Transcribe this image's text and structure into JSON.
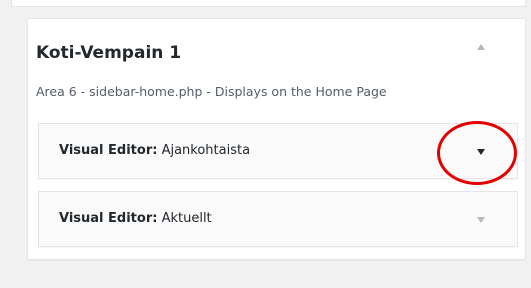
{
  "sidebar": {
    "title": "Koti-Vempain 1",
    "description": "Area 6 - sidebar-home.php - Displays on the Home Page",
    "widgets": [
      {
        "type_label": "Visual Editor:",
        "name": " Ajankohtaista",
        "arrow_color": "#23282d"
      },
      {
        "type_label": "Visual Editor:",
        "name": " Aktuellt",
        "arrow_color": "#b4b9be"
      }
    ]
  },
  "annotation": {
    "color": "#e40000",
    "icon": "highlight-circle"
  },
  "colors": {
    "background": "#f1f1f1",
    "panel": "#ffffff",
    "border": "#e5e5e5",
    "widget_bg": "#fafafa"
  }
}
